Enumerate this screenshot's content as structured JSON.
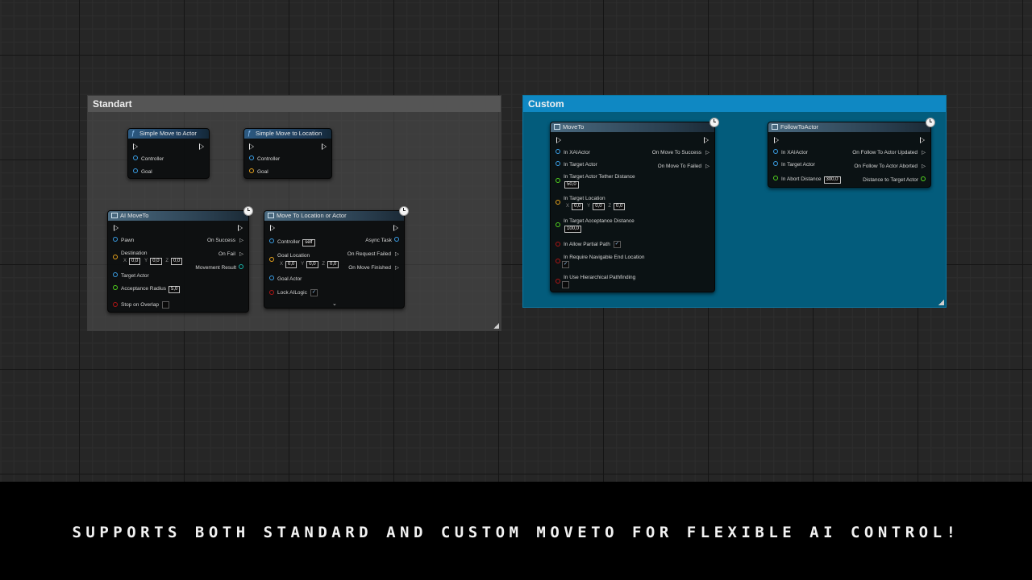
{
  "caption": "SUPPORTS BOTH STANDARD AND CUSTOM MOVETO FOR FLEXIBLE AI CONTROL!",
  "colors": {
    "object_pin": "#3aa0e8",
    "vector_pin": "#e8a31b",
    "float_pin": "#52d41f",
    "bool_pin": "#b01515",
    "custom_comment": "#0f88c3",
    "standard_comment": "#555555"
  },
  "standart": {
    "title": "Standart",
    "simple_move_to_actor": {
      "title": "Simple Move to Actor",
      "icon": "function-icon",
      "pins": [
        "Controller",
        "Goal"
      ]
    },
    "simple_move_to_location": {
      "title": "Simple Move to Location",
      "icon": "function-icon",
      "pins": [
        "Controller",
        "Goal"
      ]
    },
    "ai_moveto": {
      "title": "AI MoveTo",
      "pawn": "Pawn",
      "destination": "Destination",
      "dest_x": "0,0",
      "dest_y": "0,0",
      "dest_z": "0,0",
      "target_actor": "Target Actor",
      "acceptance_radius": "Acceptance Radius",
      "acceptance_radius_value": "5,0",
      "stop_on_overlap": "Stop on Overlap",
      "on_success": "On Success",
      "on_fail": "On Fail",
      "movement_result": "Movement Result"
    },
    "move_to_location_or_actor": {
      "title": "Move To Location or Actor",
      "controller": "Controller",
      "controller_value": "self",
      "goal_location": "Goal Location",
      "gl_x": "0,0",
      "gl_y": "0,0",
      "gl_z": "0,0",
      "goal_actor": "Goal Actor",
      "lock_ailogic": "Lock AILogic",
      "lock_ailogic_checked": "✓",
      "async_task": "Async Task",
      "on_request_failed": "On Request Failed",
      "on_move_finished": "On Move Finished"
    }
  },
  "custom": {
    "title": "Custom",
    "moveto": {
      "title": "MoveTo",
      "in_xaiactor": "In XAIActor",
      "in_target_actor": "In Target Actor",
      "tether_distance": "In Target Actor Tether Distance",
      "tether_value": "50,0",
      "target_location": "In Target Location",
      "tl_x": "0,0",
      "tl_y": "0,0",
      "tl_z": "0,0",
      "acceptance_distance": "In Target Acceptance Distance",
      "acceptance_value": "100,0",
      "allow_partial_path": "In Allow Partial Path",
      "allow_partial_checked": "✓",
      "require_navigable": "In Require Navigable End Location",
      "require_navigable_checked": "✓",
      "use_hierarchical": "In Use Hierarchical Pathfinding",
      "on_move_to_success": "On Move To Success",
      "on_move_to_failed": "On Move To Failed"
    },
    "follow_to_actor": {
      "title": "FollowToActor",
      "in_xaiactor": "In XAIActor",
      "in_target_actor": "In Target Actor",
      "abort_distance": "In Abort Distance",
      "abort_value": "300,0",
      "on_updated": "On Follow To Actor Updated",
      "on_aborted": "On Follow To Actor Aborted",
      "distance_to_target": "Distance to Target Actor"
    }
  },
  "axis": {
    "x": "X",
    "y": "Y",
    "z": "Z"
  }
}
